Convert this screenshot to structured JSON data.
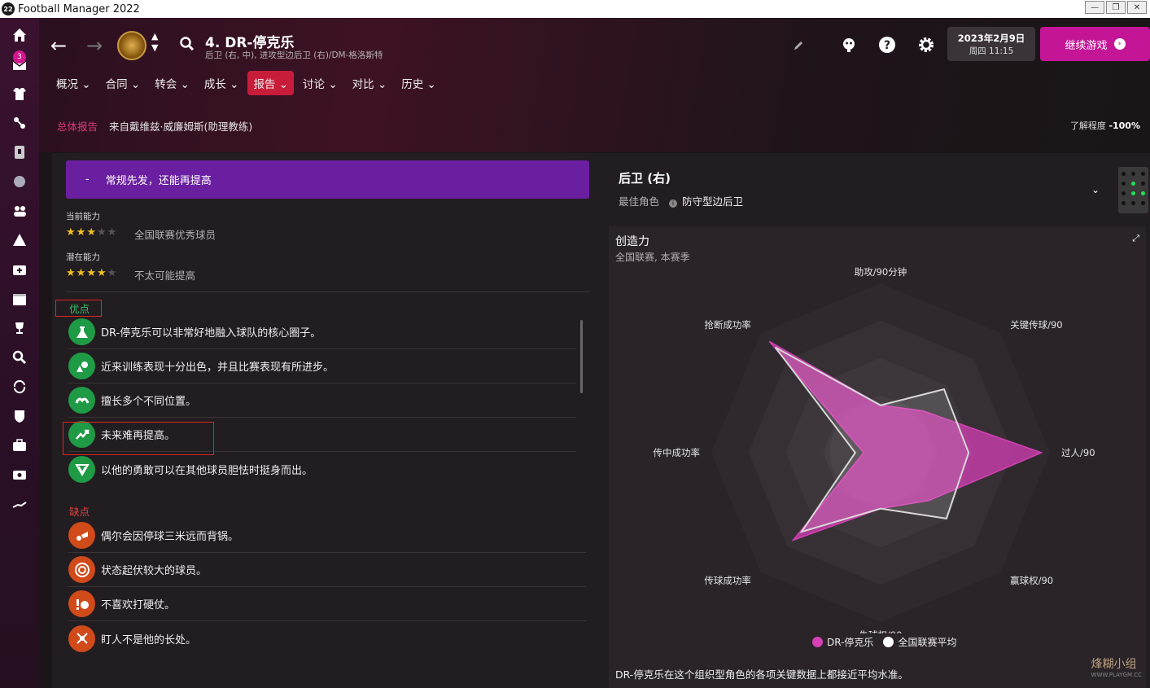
{
  "window": {
    "title": "Football Manager 2022",
    "app_badge": "22"
  },
  "sidebar": {
    "mail_count": "3"
  },
  "header": {
    "player_title": "4. DR-停克乐",
    "player_subtitle": "后卫 (右, 中), 进攻型边后卫 (右)/DM-格洛斯特",
    "date": "2023年2月9日",
    "day_time": "周四 11:15",
    "continue_label": "继续游戏"
  },
  "tabs": [
    {
      "label": "概况"
    },
    {
      "label": "合同"
    },
    {
      "label": "转会"
    },
    {
      "label": "成长"
    },
    {
      "label": "报告"
    },
    {
      "label": "讨论"
    },
    {
      "label": "对比"
    },
    {
      "label": "历史"
    }
  ],
  "subbar": {
    "section_label": "总体报告",
    "source": "来自戴维兹·威廉姆斯(助理教练)",
    "familiarity_label": "了解程度",
    "familiarity_value": "-100%"
  },
  "report": {
    "banner_dash": "-",
    "banner_text": "常规先发，还能再提高",
    "current_ability_label": "当前能力",
    "current_stars": 3,
    "current_text": "全国联赛优秀球员",
    "potential_ability_label": "潜在能力",
    "potential_stars": 4,
    "potential_text": "不太可能提高",
    "strengths_title": "优点",
    "strengths": [
      {
        "text": "DR-停克乐可以非常好地融入球队的核心圈子。",
        "icon": "flask-icon"
      },
      {
        "text": "近来训练表现十分出色，并且比赛表现有所进步。",
        "icon": "training-icon"
      },
      {
        "text": "擅长多个不同位置。",
        "icon": "positions-icon"
      },
      {
        "text": "未来难再提高。",
        "icon": "trend-up-icon"
      },
      {
        "text": "以他的勇敢可以在其他球员胆怯时挺身而出。",
        "icon": "shield-icon"
      }
    ],
    "weaknesses_title": "缺点",
    "weaknesses": [
      {
        "text": "偶尔会因停球三米远而背锅。",
        "icon": "ball-control-icon"
      },
      {
        "text": "状态起伏较大的球员。",
        "icon": "target-icon"
      },
      {
        "text": "不喜欢打硬仗。",
        "icon": "tackle-icon"
      },
      {
        "text": "盯人不是他的长处。",
        "icon": "marking-icon"
      }
    ]
  },
  "position": {
    "title": "后卫 (右)",
    "best_role_label": "最佳角色",
    "best_role": "防守型边后卫"
  },
  "chart_data": {
    "type": "radar",
    "title": "创造力",
    "subtitle": "全国联赛, 本赛季",
    "axes": [
      "助攻/90分钟",
      "关键传球/90",
      "过人/90",
      "赢球权/90",
      "失球权/90",
      "传球成功率",
      "传中成功率",
      "抢断成功率"
    ],
    "series": [
      {
        "name": "DR-停克乐",
        "color": "#d63fb5",
        "values": [
          0.28,
          0.35,
          0.95,
          0.4,
          0.33,
          0.73,
          0.1,
          0.93
        ]
      },
      {
        "name": "全国联赛平均",
        "color": "#ffffff",
        "values": [
          0.28,
          0.53,
          0.52,
          0.55,
          0.33,
          0.66,
          0.15,
          0.88
        ]
      }
    ],
    "note": "DR-停克乐在这个组织型角色的各项关键数据上都接近平均水准。"
  },
  "watermark": {
    "text": "烽糊小组",
    "url_text": "WWW.PLAYGM.CC"
  }
}
